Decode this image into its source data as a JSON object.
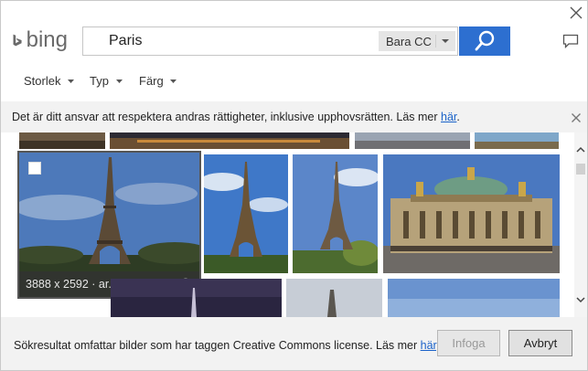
{
  "search": {
    "value": "Paris",
    "scope": "Bara CC"
  },
  "filters": [
    {
      "label": "Storlek"
    },
    {
      "label": "Typ"
    },
    {
      "label": "Färg"
    }
  ],
  "notice": {
    "text": "Det är ditt ansvar att respektera andras rättigheter, inklusive upphovsrätten. Läs mer ",
    "link": "här",
    "end": "."
  },
  "logo": {
    "text": "bing"
  },
  "hover_image": {
    "dimensions": "3888 x 2592",
    "separator": " · ",
    "source": "ar.wikipedia.org"
  },
  "footer": {
    "text": "Sökresultat omfattar bilder som har taggen Creative Commons license. Läs mer ",
    "link": "här",
    "end": ".",
    "insert_label": "Infoga",
    "cancel_label": "Avbryt"
  },
  "colors": {
    "accent": "#2d6fd0",
    "link": "#1a62c9",
    "sky": "#4f7fc3"
  },
  "icons": [
    "close-icon",
    "bing-logo-icon",
    "chevron-down-icon",
    "search-icon",
    "feedback-icon",
    "info-icon",
    "checkbox-icon"
  ]
}
